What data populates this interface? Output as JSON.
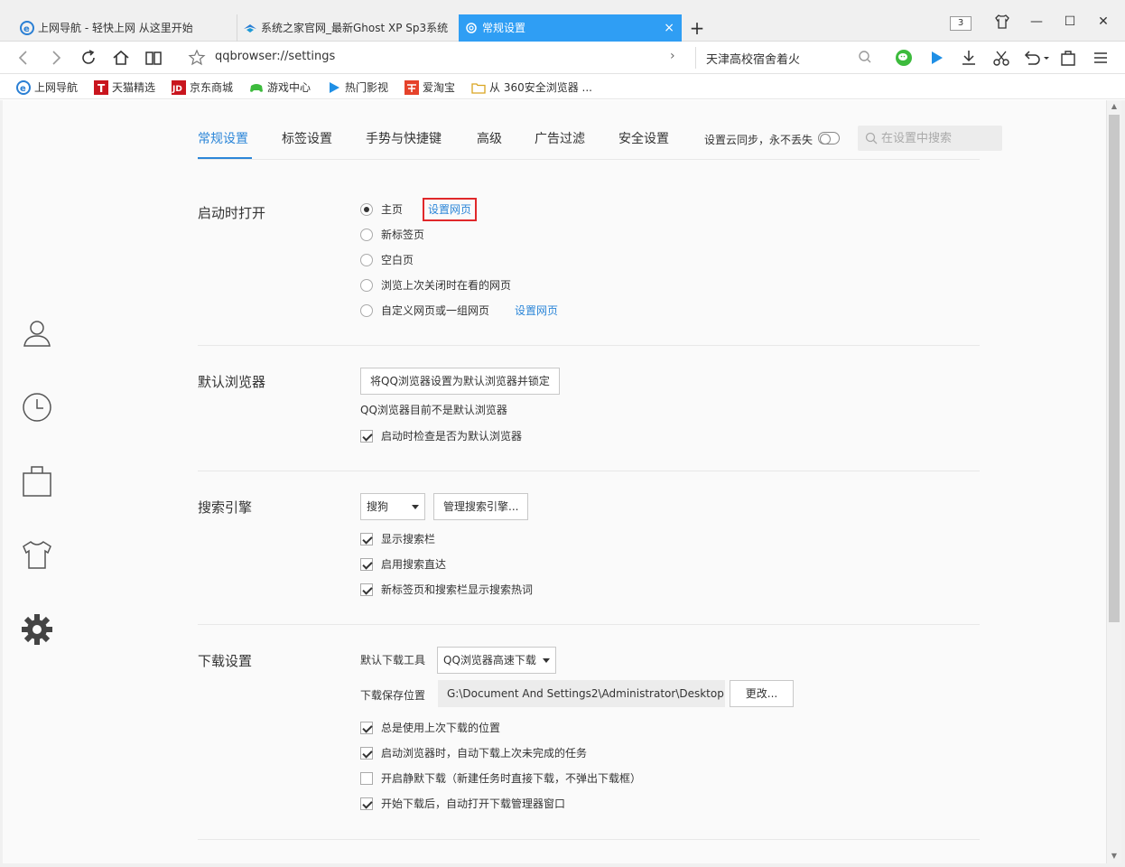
{
  "tabs": [
    {
      "title": "上网导航 - 轻快上网 从这里开始"
    },
    {
      "title": "系统之家官网_最新Ghost XP Sp3系统"
    },
    {
      "title": "常规设置",
      "close": "×"
    }
  ],
  "new_tab": "+",
  "tab_count": "3",
  "window_controls": {
    "minimize": "—",
    "maximize": "☐",
    "close": "✕"
  },
  "address": {
    "url": "qqbrowser://settings",
    "go": "›"
  },
  "search_box": {
    "hot_word": "天津高校宿舍着火"
  },
  "bookmarks": [
    {
      "label": "上网导航"
    },
    {
      "label": "天猫精选"
    },
    {
      "label": "京东商城"
    },
    {
      "label": "游戏中心"
    },
    {
      "label": "热门影视"
    },
    {
      "label": "爱淘宝"
    },
    {
      "label": "从 360安全浏览器 ..."
    }
  ],
  "settings_tabs": [
    "常规设置",
    "标签设置",
    "手势与快捷键",
    "高级",
    "广告过滤",
    "安全设置"
  ],
  "sync": {
    "label": "设置云同步，永不丢失",
    "enabled": false
  },
  "settings_search": {
    "placeholder": "在设置中搜索"
  },
  "startup": {
    "title": "启动时打开",
    "options": [
      {
        "label": "主页",
        "selected": true
      },
      {
        "label": "新标签页",
        "selected": false
      },
      {
        "label": "空白页",
        "selected": false
      },
      {
        "label": "浏览上次关闭时在看的网页",
        "selected": false
      },
      {
        "label": "自定义网页或一组网页",
        "selected": false
      }
    ],
    "home_link": "设置网页",
    "custom_link": "设置网页"
  },
  "default_browser": {
    "title": "默认浏览器",
    "button": "将QQ浏览器设置为默认浏览器并锁定",
    "status": "QQ浏览器目前不是默认浏览器",
    "check_label": "启动时检查是否为默认浏览器",
    "check_on": true
  },
  "search_engine": {
    "title": "搜索引擎",
    "selected": "搜狗",
    "manage_button": "管理搜索引擎...",
    "options": [
      {
        "label": "显示搜索栏",
        "checked": true
      },
      {
        "label": "启用搜索直达",
        "checked": true
      },
      {
        "label": "新标签页和搜索栏显示搜索热词",
        "checked": true
      }
    ]
  },
  "download": {
    "title": "下载设置",
    "tool_label": "默认下载工具",
    "tool_selected": "QQ浏览器高速下载",
    "path_label": "下载保存位置",
    "path_value": "G:\\Document And Settings2\\Administrator\\Desktop",
    "change_button": "更改...",
    "options": [
      {
        "label": "总是使用上次下载的位置",
        "checked": true
      },
      {
        "label": "启动浏览器时，自动下载上次未完成的任务",
        "checked": true
      },
      {
        "label": "开启静默下载（新建任务时直接下载，不弹出下载框）",
        "checked": false
      },
      {
        "label": "开始下载后，自动打开下载管理器窗口",
        "checked": true
      }
    ]
  },
  "colors": {
    "accent": "#2c86d8",
    "active_tab": "#2f9ef4",
    "highlight_box": "#e0282a"
  }
}
